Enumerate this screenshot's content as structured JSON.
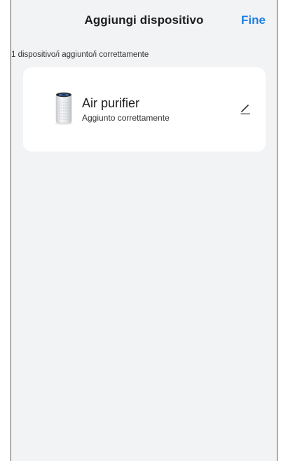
{
  "header": {
    "title": "Aggiungi dispositivo",
    "done_label": "Fine"
  },
  "status": {
    "message": "1 dispositivo/i aggiunto/i correttamente"
  },
  "device": {
    "name": "Air purifier",
    "status": "Aggiunto correttamente",
    "image_icon": "air-purifier-image",
    "edit_icon": "pencil-icon"
  },
  "colors": {
    "accent": "#1f7fe0",
    "background": "#f2f3f5",
    "card": "#ffffff"
  }
}
